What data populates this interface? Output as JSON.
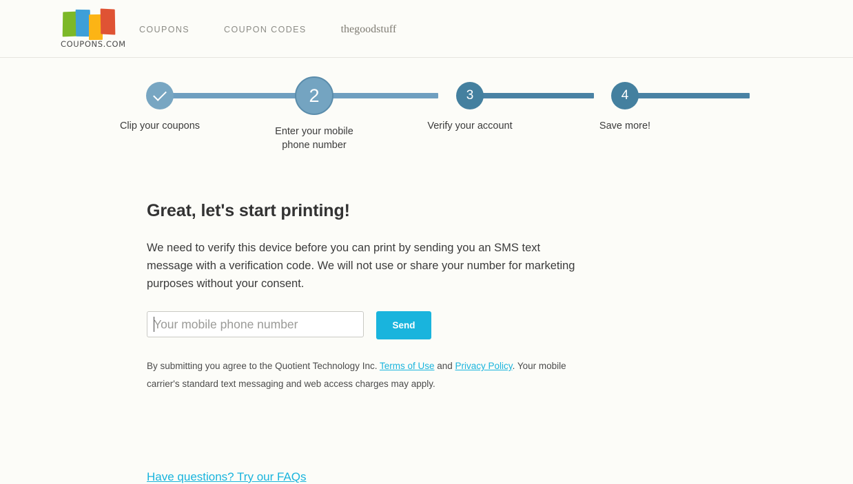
{
  "header": {
    "logo": {
      "wordmark": "COUPONS.COM",
      "icon_name": "coupons-logo",
      "colors": {
        "green": "#7cb828",
        "blue": "#3e9fd8",
        "yellow": "#fcb415",
        "red": "#df5334"
      }
    },
    "nav": [
      {
        "label": "COUPONS",
        "style": "caps"
      },
      {
        "label": "COUPON CODES",
        "style": "caps"
      },
      {
        "label": "thegoodstuff",
        "style": "serif"
      }
    ]
  },
  "stepper": {
    "current_step": 2,
    "colors": {
      "done": "#78a6c2",
      "current": "#74a4c1",
      "future": "#44809f",
      "line_light": "#6f9fc0",
      "line_dark": "#4a82a4"
    },
    "steps": [
      {
        "marker": "check",
        "label": "Clip your coupons",
        "state": "done"
      },
      {
        "marker": "2",
        "label": "Enter your mobile phone number",
        "state": "current"
      },
      {
        "marker": "3",
        "label": "Verify your account",
        "state": "future"
      },
      {
        "marker": "4",
        "label": "Save more!",
        "state": "future"
      }
    ]
  },
  "main": {
    "headline": "Great, let's start printing!",
    "body": "We need to verify this device before you can print by sending you an SMS text message with a verification code. We will not use or share your number for marketing purposes without your consent.",
    "form": {
      "phone_placeholder": "Your mobile phone number",
      "phone_value": "",
      "send_label": "Send",
      "send_color": "#19b4dd"
    },
    "fineprint": {
      "part1": "By submitting you agree to the Quotient Technology Inc. ",
      "link1": "Terms of Use",
      "part2": " and ",
      "link2": "Privacy Policy",
      "part3": ". Your mobile carrier's standard text messaging and web access charges may apply."
    }
  },
  "footer": {
    "faq_link": "Have questions? Try our FAQs"
  }
}
